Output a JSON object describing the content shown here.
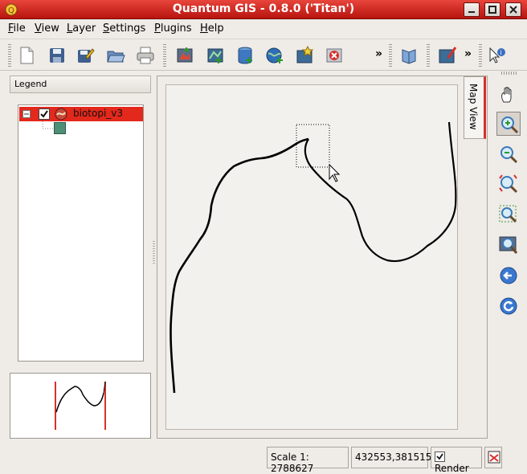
{
  "window": {
    "title": "Quantum GIS - 0.8.0 ('Titan')",
    "controls": [
      "minimize-icon",
      "maximize-icon",
      "close-icon"
    ]
  },
  "menubar": {
    "items": [
      {
        "label": "File",
        "mnemonic": "F",
        "rest": "ile"
      },
      {
        "label": "View",
        "mnemonic": "V",
        "rest": "iew"
      },
      {
        "label": "Layer",
        "mnemonic": "L",
        "rest": "ayer"
      },
      {
        "label": "Settings",
        "mnemonic": "S",
        "rest": "ettings"
      },
      {
        "label": "Plugins",
        "mnemonic": "P",
        "rest": "lugins"
      },
      {
        "label": "Help",
        "mnemonic": "H",
        "rest": "elp"
      }
    ]
  },
  "toolbar": {
    "more_label": "»",
    "buttons": [
      "new-project-icon",
      "save-project-icon",
      "save-as-icon",
      "open-project-icon",
      "print-icon",
      "add-raster-icon",
      "add-vector-icon",
      "add-postgis-icon",
      "add-wms-icon",
      "new-vector-layer-icon",
      "remove-layer-icon",
      "help-icon",
      "capture-icon",
      "identify-icon"
    ]
  },
  "legend": {
    "header": "Legend",
    "layers": [
      {
        "name": "biotopi_v3",
        "visible": true,
        "symbol_color": "#4e8f75",
        "selected": true
      }
    ]
  },
  "map": {
    "tab_label": "Map View",
    "background": "#f3f1ee",
    "line_color": "#000000"
  },
  "map_tools": [
    "pan-icon",
    "zoom-in-icon",
    "zoom-out-icon",
    "zoom-full-icon",
    "zoom-to-selection-icon",
    "zoom-to-layer-icon",
    "zoom-last-icon",
    "refresh-icon"
  ],
  "status": {
    "scale": "Scale 1: 2788627",
    "coordinates": "432553,381515",
    "render_label": "Render",
    "render_checked": true
  },
  "colors": {
    "titlebar": "#c41e17",
    "selection": "#e3281c",
    "accent_tab": "#d2322a"
  }
}
